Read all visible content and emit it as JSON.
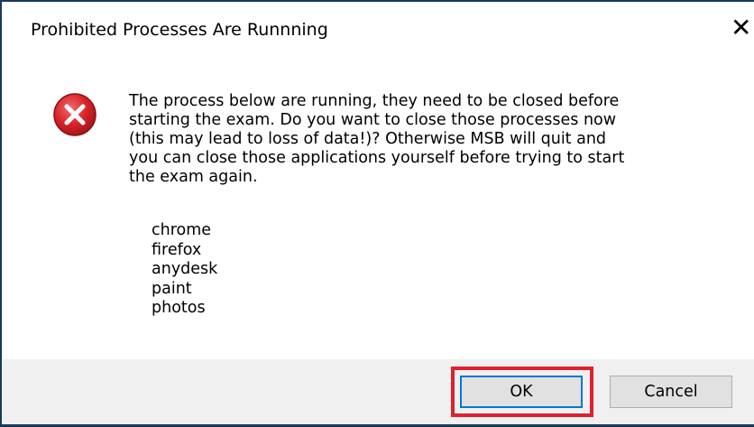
{
  "dialog": {
    "title": "Prohibited Processes Are Runnning",
    "close_glyph": "✕",
    "icon": "error-icon",
    "message_lines": [
      "The process below are running, they need to be closed before",
      "starting the exam. Do you want to close those processes now",
      "(this may lead to loss of data!)? Otherwise MSB will quit and",
      "you can close those applications yourself before trying to start",
      "the exam again."
    ],
    "processes": [
      "chrome",
      "firefox",
      "anydesk",
      "paint",
      "photos"
    ],
    "buttons": {
      "ok": "OK",
      "cancel": "Cancel"
    }
  },
  "colors": {
    "error_red": "#d8232a",
    "highlight": "#e0202e",
    "focus_border": "#0078d7",
    "window_border": "#1b3a5a"
  }
}
